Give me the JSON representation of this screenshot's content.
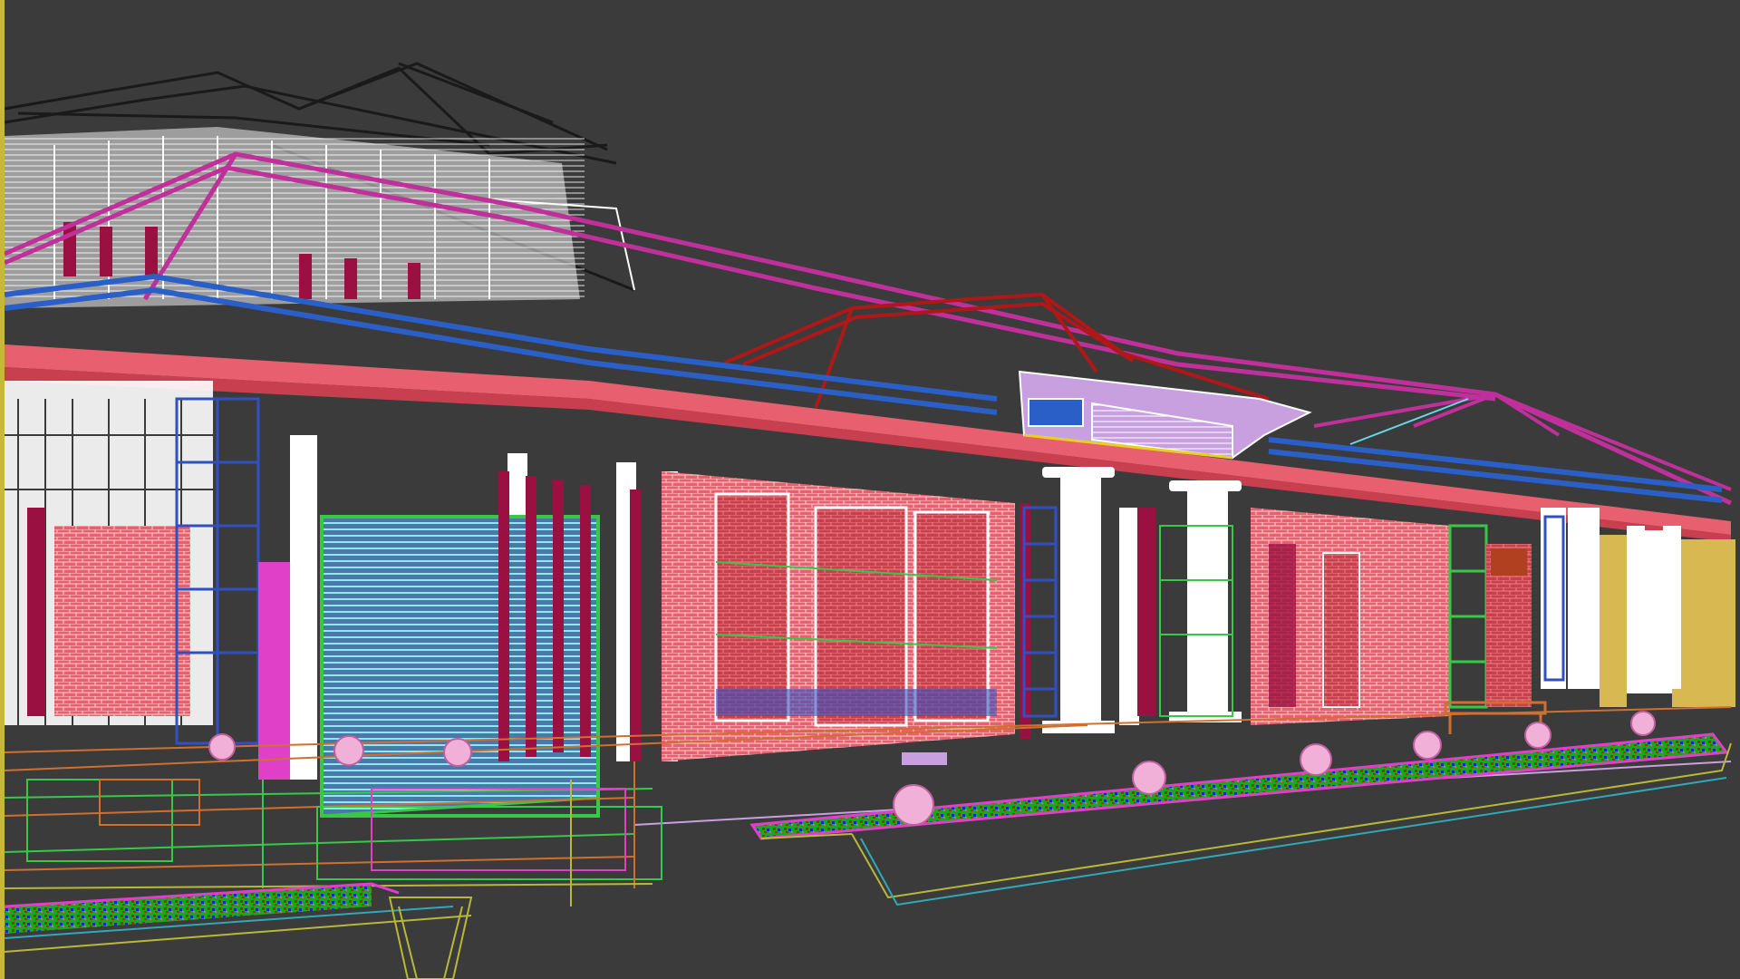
{
  "viewport": {
    "background_color": "#3b3b3b",
    "border_color": "#c8b838",
    "render_mode": "wireframe"
  },
  "scene": {
    "palette": {
      "roof_dark": "#1a1a1a",
      "roof_white": "#ffffff",
      "magenta_ridge": "#c0309a",
      "red_ridge": "#b01818",
      "blue_fascia": "#2a5fc8",
      "brick_pink": "#e86070",
      "crimson": "#9a1040",
      "column_white": "#ffffff",
      "glass_cyan": "#66d8e8",
      "frame_green": "#38c848",
      "hot_pink": "#e040c8",
      "lavender": "#c8a0e0",
      "wall_yellow": "#d8b850",
      "ground_orange": "#d07030",
      "planter_olive": "#b8b838",
      "planter_teal": "#30a8b8",
      "shrub_pink": "#f0b0d8",
      "flower_red": "#c81818",
      "flower_green": "#18a818",
      "flower_blue": "#1828c8",
      "grid_blue": "#3050c0"
    }
  }
}
